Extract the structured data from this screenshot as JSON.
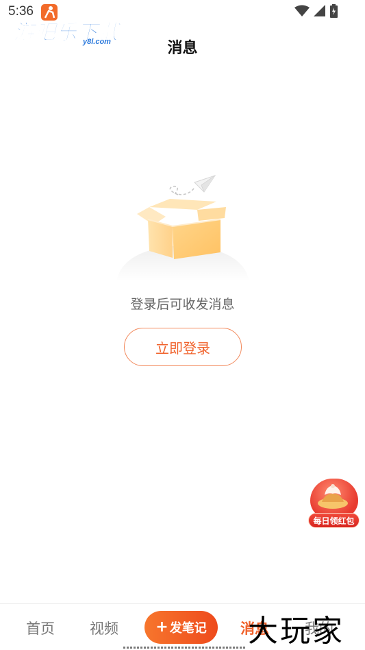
{
  "status_bar": {
    "time": "5:36",
    "icons": [
      "wifi-icon",
      "cell-signal-icon",
      "battery-icon"
    ]
  },
  "watermark_top": {
    "brand": "游吧乐下载",
    "domain": "y8l.com"
  },
  "header": {
    "title": "消息"
  },
  "empty_state": {
    "message": "登录后可收发消息",
    "login_label": "立即登录",
    "icons": [
      "empty-box-icon",
      "paper-plane-icon"
    ]
  },
  "floating_promo": {
    "label": "每日领红包"
  },
  "bottom_nav": {
    "items": [
      {
        "label": "首页",
        "active": false
      },
      {
        "label": "视频",
        "active": false
      },
      {
        "label": "发笔记",
        "type": "publish"
      },
      {
        "label": "消息",
        "active": true
      },
      {
        "label": "我的",
        "active": false
      }
    ]
  },
  "watermark_bottom": {
    "text": "大玩家"
  },
  "colors": {
    "accent": "#f0612a",
    "title": "#111111",
    "muted_text": "#666666",
    "nav_inactive": "#777777"
  }
}
